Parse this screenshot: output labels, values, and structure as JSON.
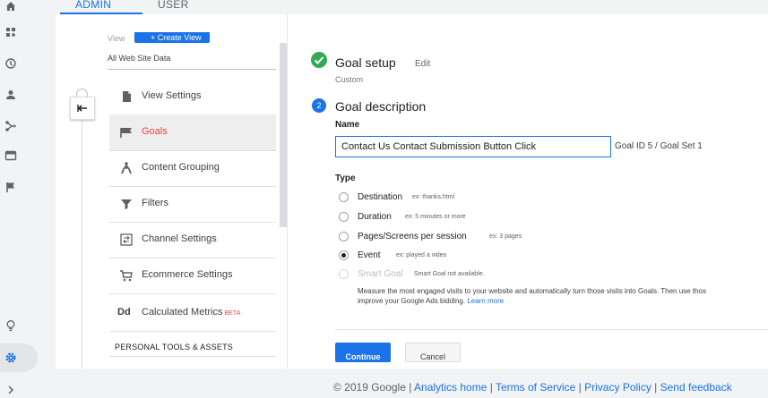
{
  "tabs": {
    "admin": "ADMIN",
    "user": "USER"
  },
  "nav": {
    "view_label": "View",
    "create_view_label": "+ Create View",
    "view_value": "All Web Site Data",
    "items": [
      {
        "label": "View Settings",
        "icon": "document-icon"
      },
      {
        "label": "Goals",
        "icon": "flag-icon"
      },
      {
        "label": "Content Grouping",
        "icon": "walking-person-icon"
      },
      {
        "label": "Filters",
        "icon": "funnel-icon"
      },
      {
        "label": "Channel Settings",
        "icon": "channel-icon"
      },
      {
        "label": "Ecommerce Settings",
        "icon": "cart-icon"
      },
      {
        "label": "Calculated Metrics",
        "icon": "dd-icon",
        "badge": "BETA"
      }
    ],
    "section_header": "PERSONAL TOOLS & ASSETS"
  },
  "goal": {
    "setup_title": "Goal setup",
    "edit_label": "Edit",
    "setup_value": "Custom",
    "step_number": "2",
    "description_title": "Goal description",
    "name_label": "Name",
    "name_value": "Contact Us Contact Submission Button Click",
    "goal_id": "Goal ID 5 / Goal Set 1",
    "type_label": "Type",
    "types": [
      {
        "label": "Destination",
        "hint": "ex: thanks.html",
        "checked": false,
        "disabled": false
      },
      {
        "label": "Duration",
        "hint": "ex: 5 minutes or more",
        "checked": false,
        "disabled": false
      },
      {
        "label": "Pages/Screens per session",
        "hint": "ex: 3 pages",
        "checked": false,
        "disabled": false
      },
      {
        "label": "Event",
        "hint": "ex: played a video",
        "checked": true,
        "disabled": false
      },
      {
        "label": "Smart Goal",
        "hint": "Smart Goal not available.",
        "checked": false,
        "disabled": true
      }
    ],
    "smart_desc_line1": "Measure the most engaged visits to your website and automatically turn those visits into Goals. Then use thos",
    "smart_desc_line2": "improve your Google Ads bidding.",
    "learn_more": "Learn more",
    "continue_label": "Continue",
    "cancel_label": "Cancel"
  },
  "footer": {
    "copyright": "© 2019 Google",
    "links": [
      "Analytics home",
      "Terms of Service",
      "Privacy Policy",
      "Send feedback"
    ]
  },
  "colors": {
    "accent": "#1a73e8",
    "success": "#34a853",
    "active_nav": "#e8453c"
  }
}
